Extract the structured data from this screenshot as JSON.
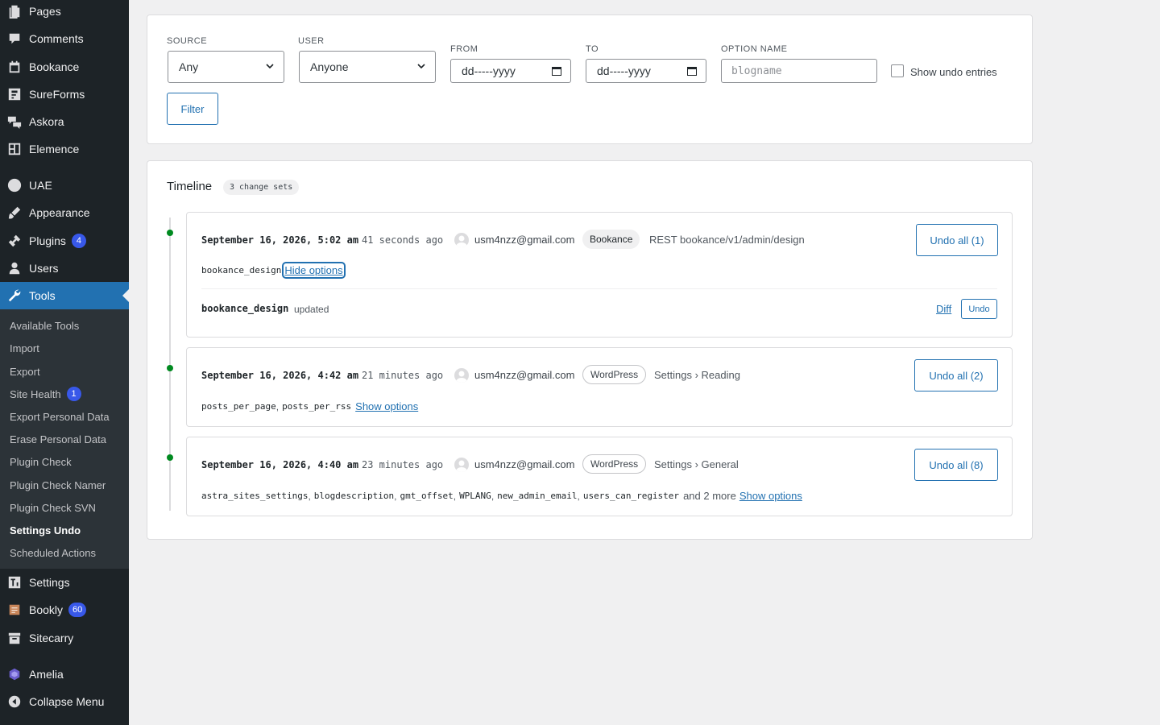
{
  "sidebar": {
    "items": [
      {
        "label": "Pages",
        "icon": "pages-icon"
      },
      {
        "label": "Comments",
        "icon": "comments-icon"
      },
      {
        "label": "Bookance",
        "icon": "calendar-icon"
      },
      {
        "label": "SureForms",
        "icon": "sureforms-icon"
      },
      {
        "label": "Askora",
        "icon": "askora-icon"
      },
      {
        "label": "Elemence",
        "icon": "elemence-icon"
      },
      {
        "label": "UAE",
        "icon": "uae-icon"
      },
      {
        "label": "Appearance",
        "icon": "brush-icon"
      },
      {
        "label": "Plugins",
        "icon": "plugin-icon",
        "badge": "4"
      },
      {
        "label": "Users",
        "icon": "users-icon"
      },
      {
        "label": "Tools",
        "icon": "wrench-icon"
      },
      {
        "label": "Settings",
        "icon": "settings-icon"
      },
      {
        "label": "Bookly",
        "icon": "bookly-icon",
        "badge": "60"
      },
      {
        "label": "Sitecarry",
        "icon": "archive-icon"
      },
      {
        "label": "Amelia",
        "icon": "amelia-icon"
      },
      {
        "label": "Collapse Menu",
        "icon": "collapse-icon"
      }
    ],
    "submenu": [
      {
        "label": "Available Tools"
      },
      {
        "label": "Import"
      },
      {
        "label": "Export"
      },
      {
        "label": "Site Health",
        "badge": "1"
      },
      {
        "label": "Export Personal Data"
      },
      {
        "label": "Erase Personal Data"
      },
      {
        "label": "Plugin Check"
      },
      {
        "label": "Plugin Check Namer"
      },
      {
        "label": "Plugin Check SVN"
      },
      {
        "label": "Settings Undo"
      },
      {
        "label": "Scheduled Actions"
      }
    ]
  },
  "filters": {
    "source_label": "SOURCE",
    "source_value": "Any",
    "user_label": "USER",
    "user_value": "Anyone",
    "from_label": "FROM",
    "from_value": "dd-----yyyy",
    "to_label": "TO",
    "to_value": "dd-----yyyy",
    "option_label": "OPTION NAME",
    "option_placeholder": "blogname",
    "show_undo_label": "Show undo entries",
    "filter_button": "Filter"
  },
  "timeline": {
    "title": "Timeline",
    "count": "3 change sets",
    "entries": [
      {
        "date": "September 16, 2026, 5:02 am",
        "ago": "41 seconds ago",
        "user": "usm4nzz@gmail.com",
        "source": "Bookance",
        "context": "REST bookance/v1/admin/design",
        "undo_all": "Undo all (1)",
        "options": [
          "bookance_design"
        ],
        "toggle": "Hide options",
        "detail": {
          "option": "bookance_design",
          "status": "updated",
          "diff": "Diff",
          "undo": "Undo"
        }
      },
      {
        "date": "September 16, 2026, 4:42 am",
        "ago": "21 minutes ago",
        "user": "usm4nzz@gmail.com",
        "source": "WordPress",
        "context": "Settings › Reading",
        "undo_all": "Undo all (2)",
        "options": [
          "posts_per_page",
          "posts_per_rss"
        ],
        "toggle": "Show options"
      },
      {
        "date": "September 16, 2026, 4:40 am",
        "ago": "23 minutes ago",
        "user": "usm4nzz@gmail.com",
        "source": "WordPress",
        "context": "Settings › General",
        "undo_all": "Undo all (8)",
        "options": [
          "astra_sites_settings",
          "blogdescription",
          "gmt_offset",
          "WPLANG",
          "new_admin_email",
          "users_can_register"
        ],
        "more": "and 2 more",
        "toggle": "Show options"
      }
    ]
  },
  "colors": {
    "sidebar_bg": "#1d2327",
    "active_menu": "#2271b1",
    "link": "#2271b1",
    "timeline_dot": "#008a20",
    "badge": "#3858e9"
  }
}
